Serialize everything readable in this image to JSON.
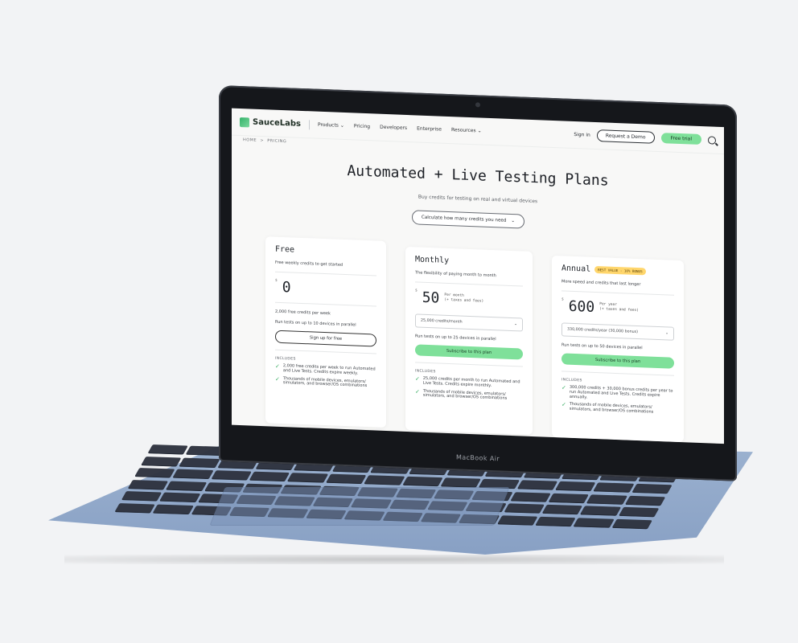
{
  "device": {
    "model_label": "MacBook Air"
  },
  "nav": {
    "brand": "SauceLabs",
    "items": [
      "Products",
      "Pricing",
      "Developers",
      "Enterprise",
      "Resources"
    ],
    "sign_in": "Sign in",
    "request_demo": "Request a Demo",
    "free_trial": "Free trial"
  },
  "breadcrumb": {
    "home": "HOME",
    "current": "PRICING"
  },
  "hero": {
    "title": "Automated + Live Testing Plans",
    "subtitle": "Buy credits for testing on real and virtual devices",
    "calculate_button": "Calculate how many credits you need"
  },
  "plans": [
    {
      "name": "Free",
      "description": "Free weekly credits to get started",
      "currency": "$",
      "price": "0",
      "note": "",
      "credits_text": "2,000 free credits per week",
      "devices_text": "Run tests on up to 10 devices in parallel",
      "button": "Sign up for free",
      "includes_label": "INCLUDES",
      "includes": [
        "2,000 free credits per week to run Automated and Live Tests. Credits expire weekly.",
        "Thousands of mobile devices, emulators/ simulators, and browser/OS combinations"
      ]
    },
    {
      "name": "Monthly",
      "description": "The flexibility of paying month to month",
      "currency": "$",
      "price": "50",
      "note": "Per month\n(+ taxes and fees)",
      "select_value": "25,000 credits/month",
      "devices_text": "Run tests on up to 25 devices in parallel",
      "button": "Subscribe to this plan",
      "includes_label": "INCLUDES",
      "includes": [
        "25,000 credits per month to run Automated and Live Tests. Credits expire monthly.",
        "Thousands of mobile devices, emulators/ simulators, and browser/OS combinations"
      ]
    },
    {
      "name": "Annual",
      "badge": "BEST VALUE - 10% BONUS",
      "description": "More speed and credits that last longer",
      "currency": "$",
      "price": "600",
      "note": "Per year\n(+ taxes and fees)",
      "select_value": "330,000 credits/year (30,000 bonus)",
      "devices_text": "Run tests on up to 50 devices in parallel",
      "button": "Subscribe to this plan",
      "includes_label": "INCLUDES",
      "includes": [
        "300,000 credits + 30,000 bonus credits per year to run Automated and Live Tests. Credits expire annually.",
        "Thousands of mobile devices, emulators/ simulators, and browser/OS combinations"
      ]
    }
  ]
}
